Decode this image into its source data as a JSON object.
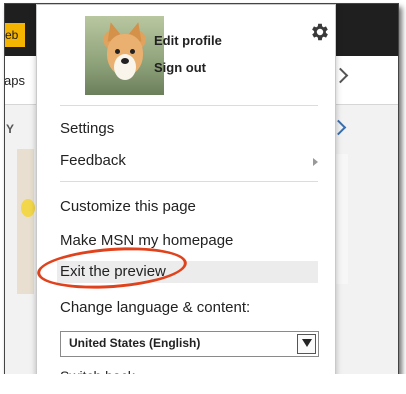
{
  "background": {
    "web_tab_label": "eb",
    "maps_label": "aps",
    "section_letter": "Y",
    "accent_color": "#f5b400",
    "topbar_color": "#1f1f1f"
  },
  "profile": {
    "avatar_alt": "corgi-avatar",
    "edit_profile_label": "Edit profile",
    "sign_out_label": "Sign out",
    "settings_icon": "gear-icon"
  },
  "menu": {
    "items": [
      {
        "label": "Settings"
      },
      {
        "label": "Feedback",
        "has_submenu": true
      },
      {
        "label": "Customize this page"
      },
      {
        "label": "Make MSN my homepage"
      },
      {
        "label": "Exit the preview",
        "highlighted": true
      }
    ],
    "language_heading": "Change language & content:",
    "language_select": {
      "selected": "United States (English)"
    },
    "cutoff_item": "Switch back"
  },
  "annotation": {
    "oval_color": "#e0421c"
  }
}
